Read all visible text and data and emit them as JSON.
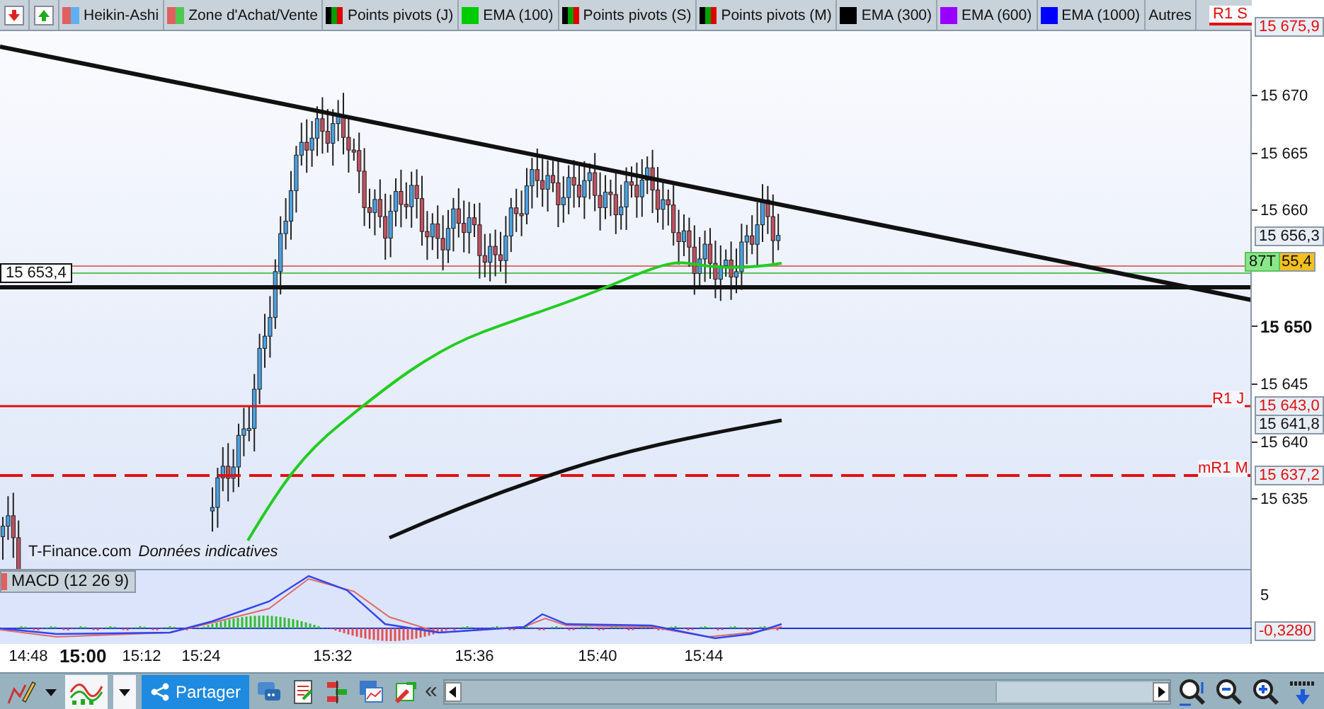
{
  "indicator_tabs": [
    {
      "label": "Heikin-Ashi",
      "kind": "candles"
    },
    {
      "label": "Zone d'Achat/Vente",
      "kind": "zone"
    },
    {
      "label": "Points pivots (J)",
      "kind": "pivots"
    },
    {
      "label": "EMA (100)",
      "kind": "ema",
      "color": "#00cc00"
    },
    {
      "label": "Points pivots (S)",
      "kind": "pivots"
    },
    {
      "label": "Points pivots (M)",
      "kind": "pivots"
    },
    {
      "label": "EMA (300)",
      "kind": "ema",
      "color": "#000000"
    },
    {
      "label": "EMA (600)",
      "kind": "ema",
      "color": "#9900ff"
    },
    {
      "label": "EMA (1000)",
      "kind": "ema",
      "color": "#0000ff"
    },
    {
      "label": "Autres",
      "kind": "other"
    }
  ],
  "price_chart": {
    "level_labels": [
      {
        "label": "R1 S"
      },
      {
        "label": "R1 J"
      },
      {
        "label": "mR1 M"
      }
    ],
    "crosshair_price": "15 653,4",
    "attribution": "T-Finance.com",
    "notice": "Données indicatives",
    "axis_ticks": [
      {
        "label": "15 670",
        "bold": false
      },
      {
        "label": "15 665",
        "bold": false
      },
      {
        "label": "15 660",
        "bold": false
      },
      {
        "label": "15 650",
        "bold": true
      },
      {
        "label": "15 645",
        "bold": false
      },
      {
        "label": "15 640",
        "bold": false
      },
      {
        "label": "15 635",
        "bold": false
      }
    ],
    "axis_markers": [
      {
        "label": "15 675,9",
        "kind": "pivot"
      },
      {
        "label": "15 656,3",
        "kind": "price"
      },
      {
        "label": "87T",
        "kind": "volume"
      },
      {
        "label": "55,4",
        "kind": "last"
      },
      {
        "label": "15 643,0",
        "kind": "pivot"
      },
      {
        "label": "15 641,8",
        "kind": "price"
      },
      {
        "label": "15 637,2",
        "kind": "pivot"
      }
    ]
  },
  "macd": {
    "label": "MACD (12 26 9)",
    "axis_tick": "5",
    "value": "-0,3280"
  },
  "time_axis": [
    {
      "label": "14:48",
      "bold": false
    },
    {
      "label": "15:00",
      "bold": true
    },
    {
      "label": "15:12",
      "bold": false
    },
    {
      "label": "15:24",
      "bold": false
    },
    {
      "label": "15:32",
      "bold": false
    },
    {
      "label": "15:36",
      "bold": false
    },
    {
      "label": "15:40",
      "bold": false
    },
    {
      "label": "15:44",
      "bold": false
    }
  ],
  "toolbar": {
    "share_label": "Partager",
    "collapse_glyph": "«"
  }
}
